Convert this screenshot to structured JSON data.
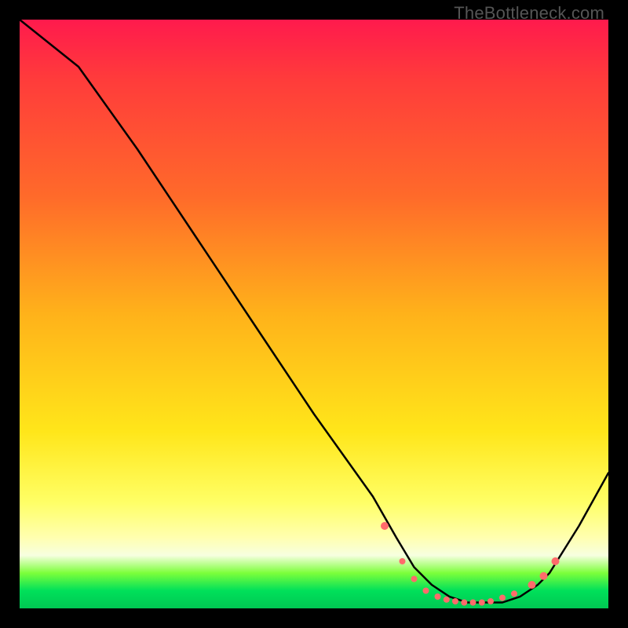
{
  "watermark": "TheBottleneck.com",
  "chart_data": {
    "type": "line",
    "title": "",
    "xlabel": "",
    "ylabel": "",
    "xlim": [
      0,
      100
    ],
    "ylim": [
      0,
      100
    ],
    "grid": false,
    "legend": false,
    "series": [
      {
        "name": "bottleneck-curve",
        "color": "#000000",
        "x": [
          0,
          5,
          10,
          20,
          30,
          40,
          50,
          55,
          60,
          64,
          67,
          70,
          73,
          76,
          79,
          82,
          85,
          88,
          90,
          95,
          100
        ],
        "y": [
          100,
          96,
          92,
          78,
          63,
          48,
          33,
          26,
          19,
          12,
          7,
          4,
          2,
          1,
          1,
          1,
          2,
          4,
          6,
          14,
          23
        ]
      }
    ],
    "markers": {
      "name": "bottom-dots",
      "color": "#ff6b6b",
      "radius_small": 4,
      "radius_large": 5,
      "points": [
        {
          "x": 62,
          "y": 14,
          "r": "large"
        },
        {
          "x": 65,
          "y": 8,
          "r": "small"
        },
        {
          "x": 67,
          "y": 5,
          "r": "small"
        },
        {
          "x": 69,
          "y": 3,
          "r": "small"
        },
        {
          "x": 71,
          "y": 2,
          "r": "small"
        },
        {
          "x": 72.5,
          "y": 1.5,
          "r": "small"
        },
        {
          "x": 74,
          "y": 1.2,
          "r": "small"
        },
        {
          "x": 75.5,
          "y": 1,
          "r": "small"
        },
        {
          "x": 77,
          "y": 1,
          "r": "small"
        },
        {
          "x": 78.5,
          "y": 1,
          "r": "small"
        },
        {
          "x": 80,
          "y": 1.2,
          "r": "small"
        },
        {
          "x": 82,
          "y": 1.8,
          "r": "small"
        },
        {
          "x": 84,
          "y": 2.5,
          "r": "small"
        },
        {
          "x": 87,
          "y": 4,
          "r": "large"
        },
        {
          "x": 89,
          "y": 5.5,
          "r": "large"
        },
        {
          "x": 91,
          "y": 8,
          "r": "large"
        }
      ]
    }
  }
}
